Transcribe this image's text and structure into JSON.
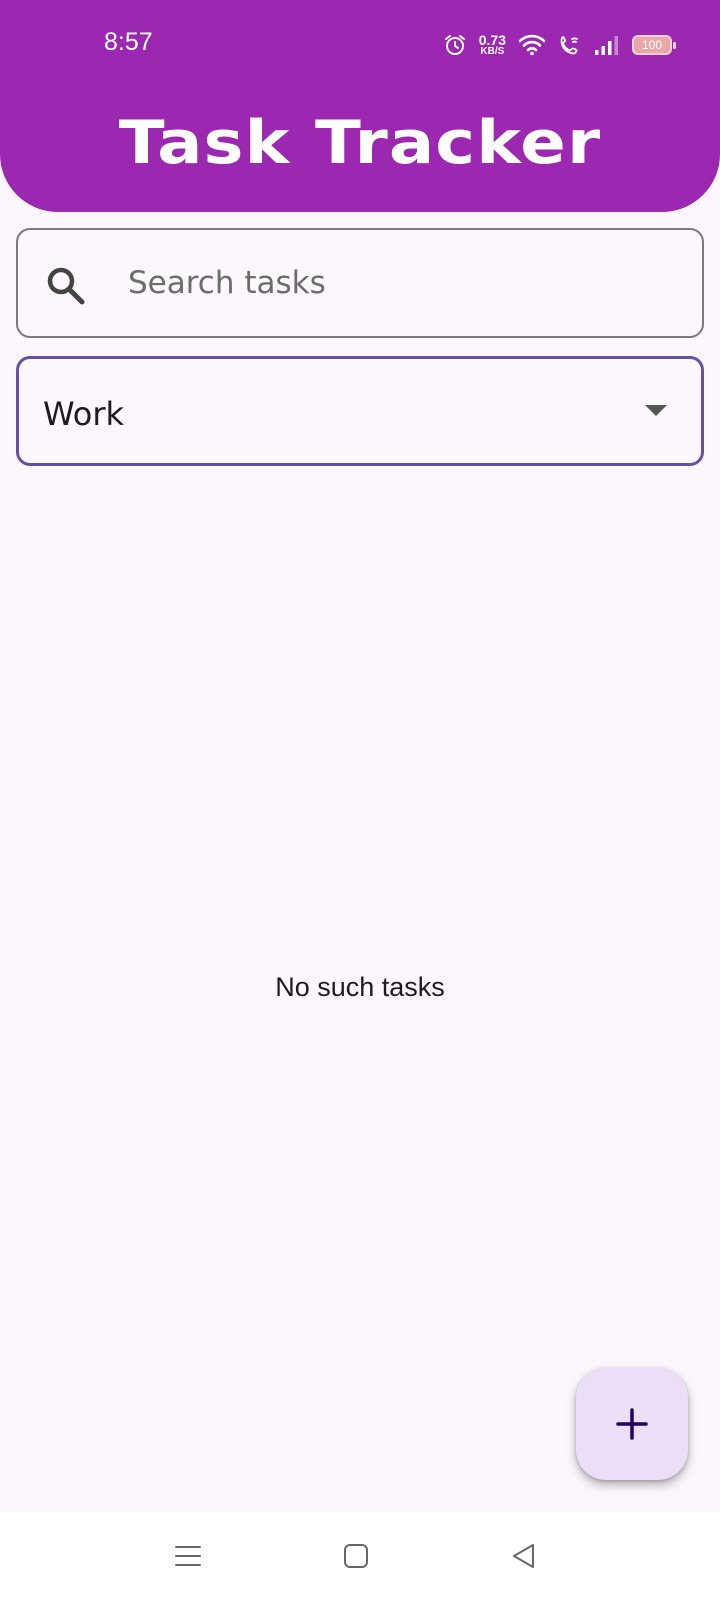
{
  "status_bar": {
    "time": "8:57",
    "net_speed_value": "0.73",
    "net_speed_unit": "KB/S",
    "battery": "100"
  },
  "header": {
    "title": "Task Tracker",
    "background_color": "#9c27b0"
  },
  "search": {
    "placeholder": "Search tasks",
    "value": "",
    "icon": "search-icon"
  },
  "filter": {
    "selected": "Work",
    "border_color": "#6750a4"
  },
  "empty_state": {
    "message": "No such tasks"
  },
  "fab": {
    "icon": "plus-icon",
    "background_color": "#ebdef9"
  },
  "nav": {
    "items": [
      "menu-icon",
      "home-icon",
      "back-icon"
    ]
  }
}
